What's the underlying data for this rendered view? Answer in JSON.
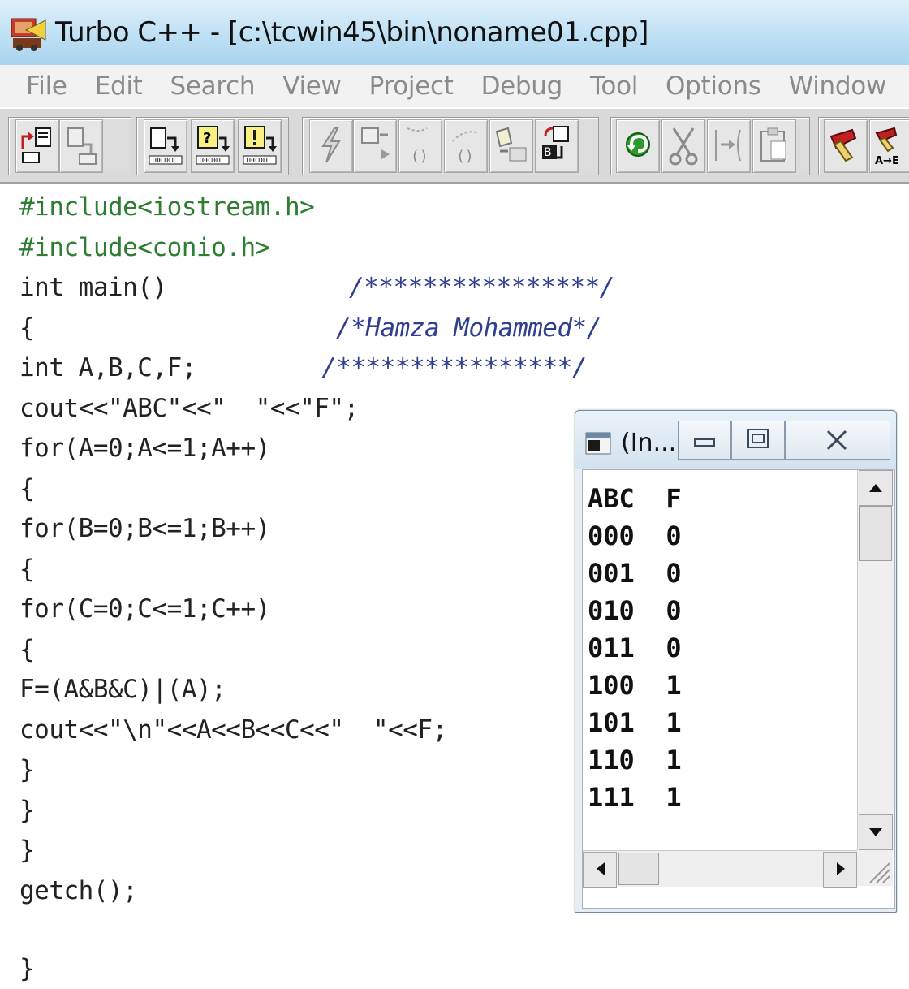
{
  "window": {
    "title": "Turbo C++ - [c:\\tcwin45\\bin\\noname01.cpp]"
  },
  "menu": [
    "File",
    "Edit",
    "Search",
    "View",
    "Project",
    "Debug",
    "Tool",
    "Options",
    "Window"
  ],
  "toolbar": {
    "buttons": [
      "open-project-icon",
      "close-project-icon",
      "step-over-icon",
      "trace-into-icon",
      "run-to-cursor-icon",
      "lightning-icon",
      "toggle-breakpoint-icon",
      "inspect-icon",
      "evaluate-icon",
      "add-watch-icon",
      "build-icon",
      "undo-icon",
      "cut-icon",
      "copy-icon",
      "paste-icon",
      "find-icon",
      "replace-icon"
    ],
    "replace_label": "A→E"
  },
  "code": {
    "line1": "#include<iostream.h>",
    "line2": "#include<conio.h>",
    "line3": "int main()",
    "line3_comment": "/****************/",
    "line4": "{",
    "line4_comment": "/*Hamza Mohammed*/",
    "line5": "int A,B,C,F;",
    "line5_comment": "/****************/",
    "line6": "cout<<\"ABC\"<<\"  \"<<\"F\";",
    "line7": "for(A=0;A<=1;A++)",
    "line8": "{",
    "line9": "for(B=0;B<=1;B++)",
    "line10": "{",
    "line11": "for(C=0;C<=1;C++)",
    "line12": "{",
    "line13": "F=(A&B&C)|(A);",
    "line14": "cout<<\"\\n\"<<A<<B<<C<<\"  \"<<F;",
    "line15": "}",
    "line16": "}",
    "line17": "}",
    "line18": "getch();",
    "line19": "}"
  },
  "console": {
    "title": "(In...",
    "output": [
      "ABC  F",
      "000  0",
      "001  0",
      "010  0",
      "011  0",
      "100  1",
      "101  1",
      "110  1",
      "111  1"
    ]
  },
  "colors": {
    "titlebar": "#bfe0f4",
    "menu_text": "#8b8b8b",
    "preprocessor": "#2e7d32",
    "comment": "#2f3e8f",
    "toolbar_bg": "#d9d9d9"
  }
}
